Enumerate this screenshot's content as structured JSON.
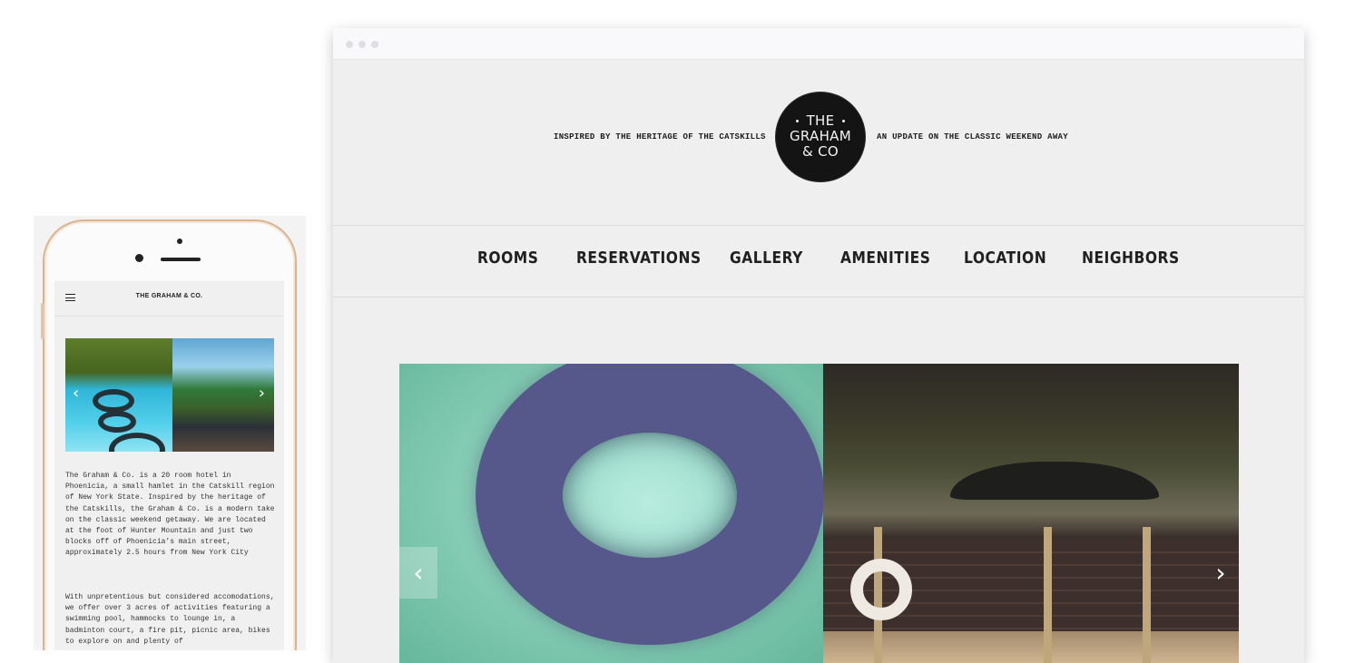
{
  "mobile": {
    "title": "THE GRAHAM & CO.",
    "menu_icon": "hamburger-menu-icon",
    "slider": {
      "prev": "‹",
      "next": "›"
    },
    "paragraph1": "The Graham & Co. is a 20 room hotel in Phoenicia, a small hamlet in the Catskill region of New York State. Inspired by the heritage of the Catskills, the Graham & Co. is a modern take on the classic weekend getaway. We are located at the foot of Hunter Mountain and just two blocks off of Phoenicia’s main street, approximately 2.5 hours from New York City",
    "paragraph2": "With unpretentious but considered accomodations, we offer over 3 acres of activities featuring a swimming pool, hammocks to lounge in, a badminton court, a fire pit, picnic area, bikes to explore on and plenty of"
  },
  "desktop": {
    "tagline_left": "INSPIRED BY THE HERITAGE OF THE CATSKILLS",
    "tagline_right": "AN UPDATE ON THE CLASSIC WEEKEND AWAY",
    "logo": {
      "line1": "THE",
      "line2": "GRAHAM",
      "line3": "& CO"
    },
    "nav": [
      "ROOMS",
      "RESERVATIONS",
      "GALLERY",
      "AMENITIES",
      "LOCATION",
      "NEIGHBORS"
    ],
    "slider": {
      "prev": "‹",
      "next": "›"
    }
  },
  "colors": {
    "background": "#efefef",
    "text": "#202020",
    "phone_frame": "#d9b48f",
    "logo_bg": "#141414"
  }
}
